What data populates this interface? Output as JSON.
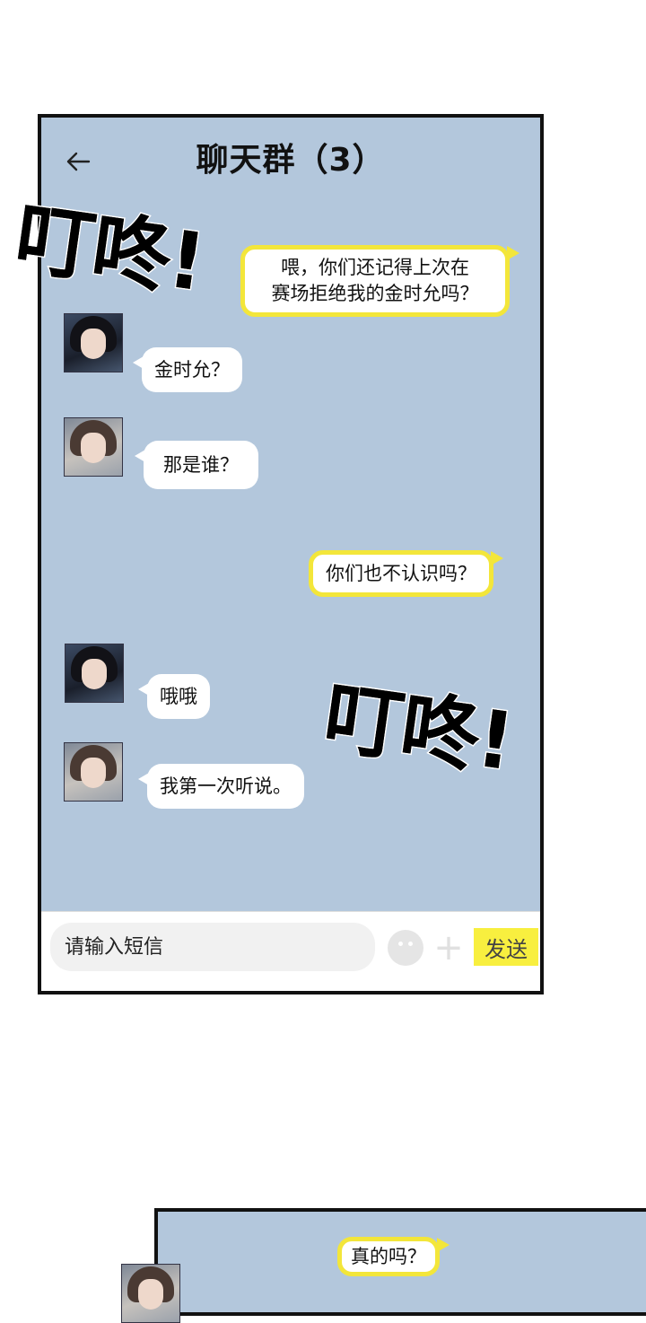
{
  "header": {
    "title": "聊天群（3）"
  },
  "messages": [
    {
      "text_line1": "喂，你们还记得上次在",
      "text_line2": "赛场拒绝我的金时允吗？"
    },
    {
      "text": "金时允？"
    },
    {
      "text": "那是谁？"
    },
    {
      "text": "你们也不认识吗？"
    },
    {
      "text": "哦哦"
    },
    {
      "text": "我第一次听说。"
    }
  ],
  "sfx": {
    "top": "叮咚!",
    "middle": "叮咚!"
  },
  "composer": {
    "placeholder": "请输入短信",
    "send_label": "发送"
  },
  "next_panel": {
    "message": "真的吗？"
  }
}
